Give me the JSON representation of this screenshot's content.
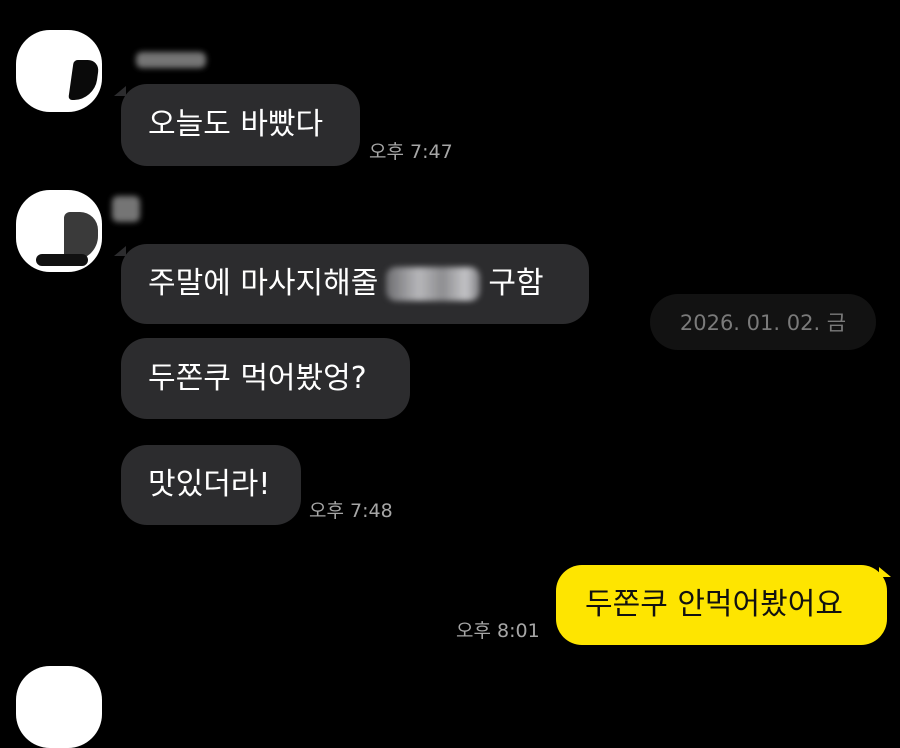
{
  "messages": {
    "m1": {
      "text": "오늘도 바빴다",
      "time": "오후 7:47"
    },
    "m2": {
      "before": "주말에 마사지해줄",
      "after": "구함"
    },
    "m3": {
      "text": "두쫀쿠 먹어봤엉?"
    },
    "m4": {
      "text": "맛있더라!",
      "time": "오후 7:48"
    },
    "m5": {
      "text": "두쫀쿠 안먹어봤어요",
      "time": "오후 8:01"
    }
  },
  "date_divider": "2026. 01. 02. 금",
  "colors": {
    "background": "#000000",
    "incoming_bubble": "#2c2c2e",
    "outgoing_bubble": "#fee500",
    "timestamp": "#a6a6a6"
  }
}
